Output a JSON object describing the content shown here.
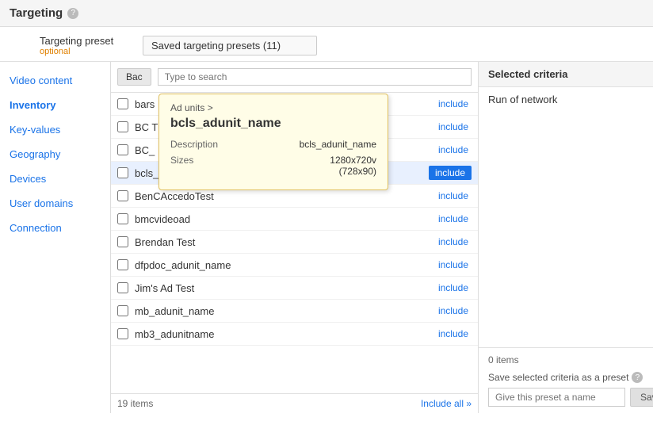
{
  "header": {
    "title": "Targeting",
    "help_label": "?"
  },
  "preset_row": {
    "label": "Targeting preset",
    "optional": "optional",
    "dropdown_text": "Saved targeting presets (11)"
  },
  "sidebar": {
    "items": [
      {
        "label": "Video content",
        "active": false
      },
      {
        "label": "Inventory",
        "active": true
      },
      {
        "label": "Key-values",
        "active": false
      },
      {
        "label": "Geography",
        "active": false
      },
      {
        "label": "Devices",
        "active": false
      },
      {
        "label": "User domains",
        "active": false
      },
      {
        "label": "Connection",
        "active": false
      }
    ]
  },
  "center_panel": {
    "back_button": "Bac",
    "search_placeholder": "Type to search",
    "items": [
      {
        "name": "bars",
        "include": "include",
        "checked": false,
        "highlighted": false
      },
      {
        "name": "BC T",
        "include": "include",
        "checked": false,
        "highlighted": false
      },
      {
        "name": "BC_",
        "include": "include",
        "checked": false,
        "highlighted": false
      },
      {
        "name": "bcls_adunit_name",
        "include": "include",
        "checked": false,
        "highlighted": true
      },
      {
        "name": "BenCAccedoTest",
        "include": "include",
        "checked": false,
        "highlighted": false
      },
      {
        "name": "bmcvideoad",
        "include": "include",
        "checked": false,
        "highlighted": false
      },
      {
        "name": "Brendan Test",
        "include": "include",
        "checked": false,
        "highlighted": false
      },
      {
        "name": "dfpdoc_adunit_name",
        "include": "include",
        "checked": false,
        "highlighted": false
      },
      {
        "name": "Jim's Ad Test",
        "include": "include",
        "checked": false,
        "highlighted": false
      },
      {
        "name": "mb_adunit_name",
        "include": "include",
        "checked": false,
        "highlighted": false
      },
      {
        "name": "mb3_adunitname",
        "include": "include",
        "checked": false,
        "highlighted": false
      }
    ],
    "footer_count": "19 items",
    "include_all": "Include all »"
  },
  "tooltip": {
    "breadcrumb": "Ad units >",
    "title": "bcls_adunit_name",
    "description_label": "Description",
    "description_value": "bcls_adunit_name",
    "sizes_label": "Sizes",
    "sizes_value": "1280x720v\n(728x90)"
  },
  "right_panel": {
    "header": "Selected criteria",
    "run_of_network": "Run of network",
    "footer_count": "0 items",
    "save_label": "Save selected criteria as a preset",
    "help_label": "?",
    "name_placeholder": "Give this preset a name",
    "save_button": "Save"
  },
  "colors": {
    "accent_blue": "#1a73e8",
    "optional_orange": "#e08000",
    "tooltip_bg": "#fffde7"
  }
}
